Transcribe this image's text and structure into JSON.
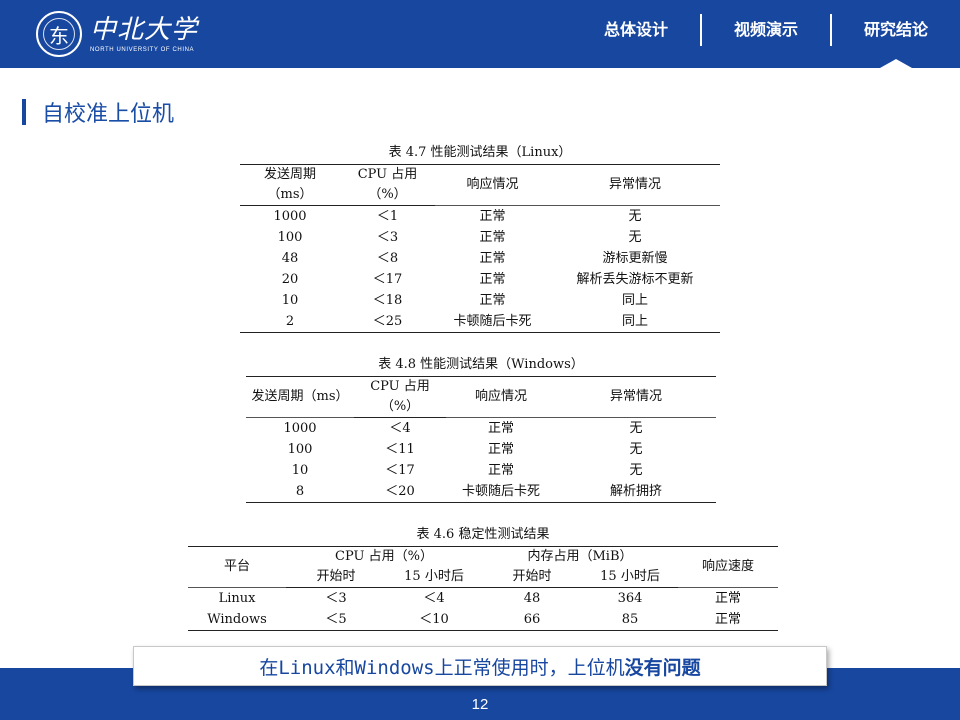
{
  "header": {
    "logo_glyph": "东",
    "logo_cn": "中北大学",
    "logo_en": "NORTH UNIVERSITY OF CHINA",
    "nav": [
      "总体设计",
      "视频演示",
      "研究结论"
    ],
    "active_nav": 2
  },
  "section_title": "自校准上位机",
  "table1": {
    "caption": "表 4.7 性能测试结果（Linux）",
    "headers": {
      "period": "发送周期",
      "period_unit": "（ms）",
      "cpu": "CPU 占用",
      "cpu_unit": "（%）",
      "response": "响应情况",
      "abnormal": "异常情况"
    },
    "rows": [
      [
        "1000",
        "＜1",
        "正常",
        "无"
      ],
      [
        "100",
        "＜3",
        "正常",
        "无"
      ],
      [
        "48",
        "＜8",
        "正常",
        "游标更新慢"
      ],
      [
        "20",
        "＜17",
        "正常",
        "解析丢失游标不更新"
      ],
      [
        "10",
        "＜18",
        "正常",
        "同上"
      ],
      [
        "2",
        "＜25",
        "卡顿随后卡死",
        "同上"
      ]
    ]
  },
  "table2": {
    "caption": "表 4.8 性能测试结果（Windows）",
    "headers": {
      "period": "发送周期（ms）",
      "cpu": "CPU 占用",
      "cpu_unit": "（%）",
      "response": "响应情况",
      "abnormal": "异常情况"
    },
    "rows": [
      [
        "1000",
        "＜4",
        "正常",
        "无"
      ],
      [
        "100",
        "＜11",
        "正常",
        "无"
      ],
      [
        "10",
        "＜17",
        "正常",
        "无"
      ],
      [
        "8",
        "＜20",
        "卡顿随后卡死",
        "解析拥挤"
      ]
    ]
  },
  "table3": {
    "caption": "表 4.6 稳定性测试结果",
    "headers": {
      "platform": "平台",
      "cpu": "CPU 占用（%）",
      "mem": "内存占用（MiB）",
      "speed": "响应速度",
      "start": "开始时",
      "after": "15 小时后"
    },
    "rows": [
      [
        "Linux",
        "＜3",
        "＜4",
        "48",
        "364",
        "正常"
      ],
      [
        "Windows",
        "＜5",
        "＜10",
        "66",
        "85",
        "正常"
      ]
    ]
  },
  "note": {
    "text_plain": "在Linux和Windows上正常使用时，上位机",
    "text_bold": "没有问题"
  },
  "page_number": "12"
}
